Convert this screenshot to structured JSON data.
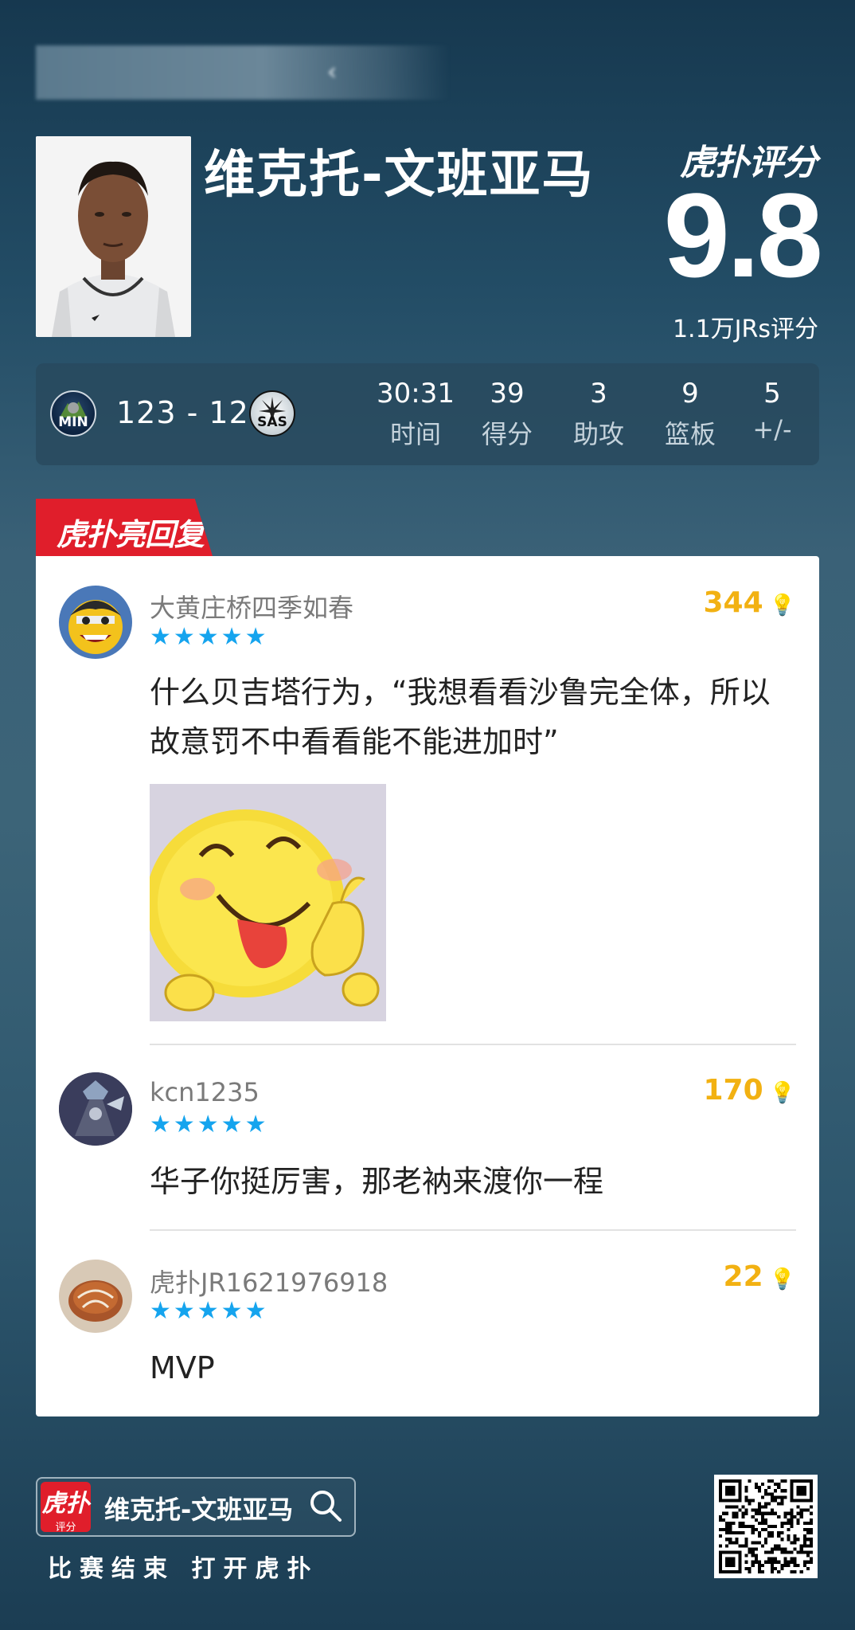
{
  "header": {
    "player_name": "维克托-文班亚马",
    "brand": "虎扑评分",
    "score": "9.8",
    "score_sub": "1.1万JRs评分"
  },
  "game": {
    "home_team": "MIN",
    "away_team": "SAS",
    "score": "123 - 126",
    "stats": [
      {
        "value": "30:31",
        "label": "时间"
      },
      {
        "value": "39",
        "label": "得分"
      },
      {
        "value": "3",
        "label": "助攻"
      },
      {
        "value": "9",
        "label": "篮板"
      },
      {
        "value": "5",
        "label": "+/-"
      }
    ]
  },
  "section_tag": "虎扑亮回复",
  "comments": [
    {
      "user": "大黄庄桥四季如春",
      "stars": "★★★★★",
      "likes": "344",
      "text": "什么贝吉塔行为，“我想看看沙鲁完全体，所以故意罚不中看看能不能进加时”"
    },
    {
      "user": "kcn1235",
      "stars": "★★★★★",
      "likes": "170",
      "text": "华子你挺厉害，那老衲来渡你一程"
    },
    {
      "user": "虎扑JR1621976918",
      "stars": "★★★★★",
      "likes": "22",
      "text": "MVP"
    }
  ],
  "footer": {
    "logo_top": "虎扑",
    "logo_bottom": "评分",
    "search_query": "维克托-文班亚马",
    "cta": "比赛结束 打开虎扑"
  },
  "colors": {
    "accent_red": "#e01e2b",
    "star_blue": "#15a4ee",
    "likes_gold": "#f2b112"
  },
  "icons": [
    "back-arrow-icon",
    "search-icon",
    "lightbulb-icon",
    "star-icon",
    "qr-code"
  ]
}
